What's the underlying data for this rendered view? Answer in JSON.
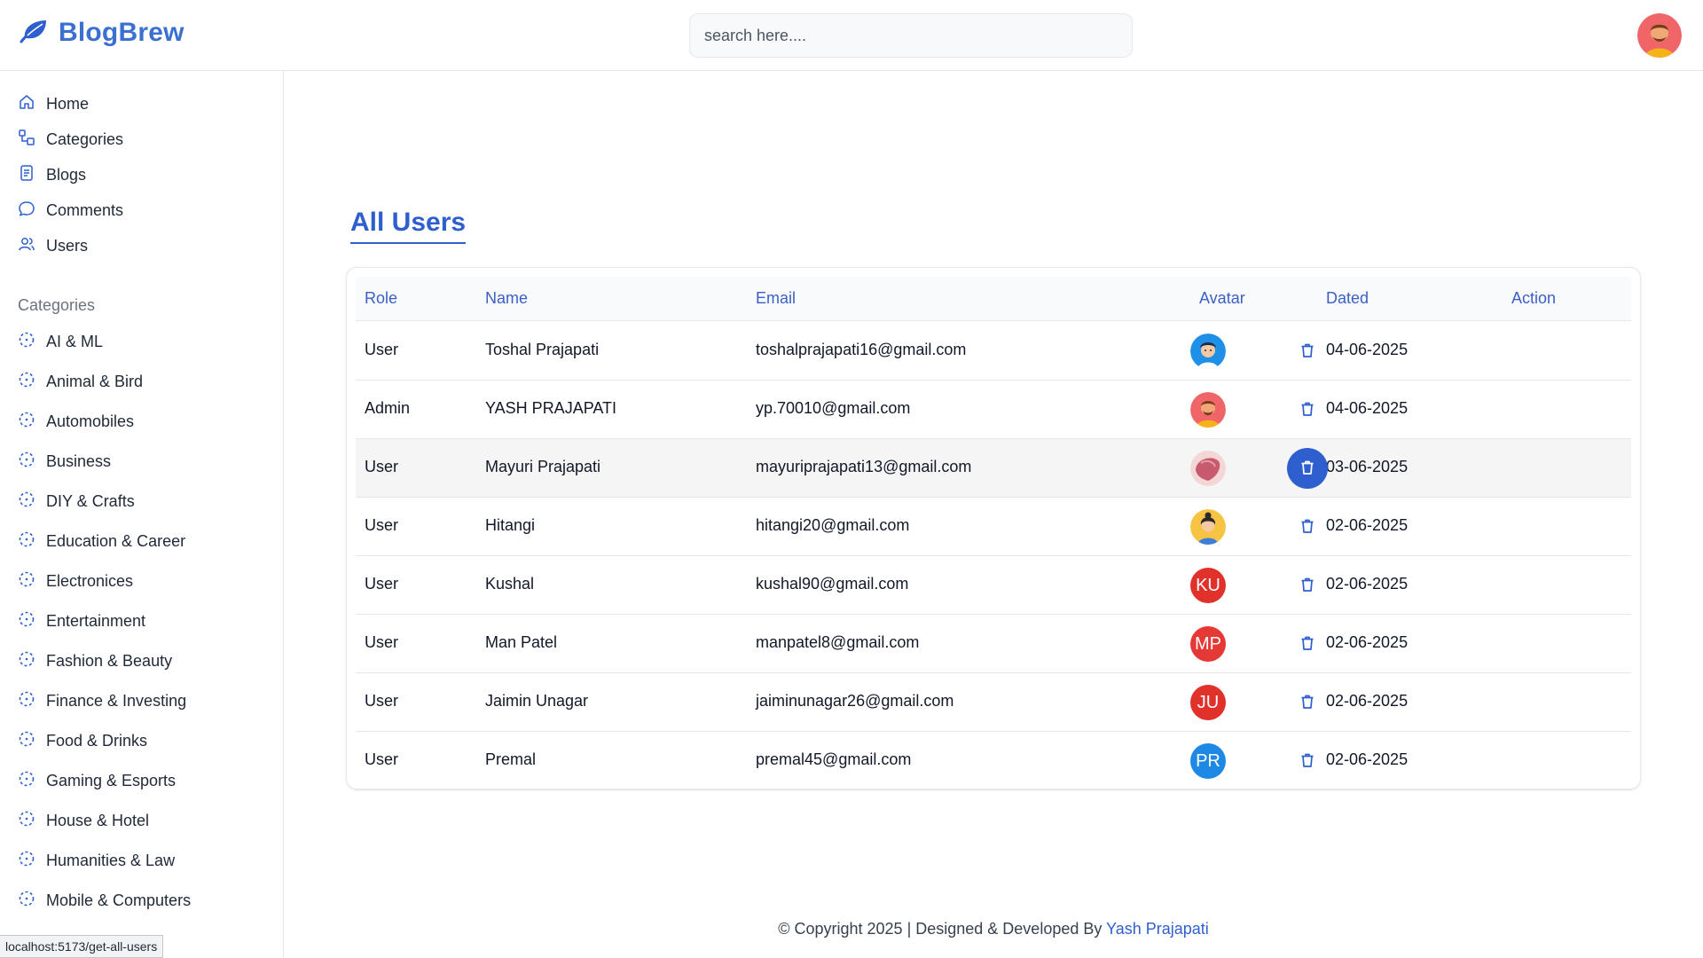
{
  "app": {
    "name": "BlogBrew"
  },
  "search": {
    "placeholder": "search here...."
  },
  "sidebar": {
    "nav": [
      {
        "label": "Home",
        "icon": "home-icon"
      },
      {
        "label": "Categories",
        "icon": "categories-icon"
      },
      {
        "label": "Blogs",
        "icon": "blogs-icon"
      },
      {
        "label": "Comments",
        "icon": "comment-icon"
      },
      {
        "label": "Users",
        "icon": "users-icon"
      }
    ],
    "categories_heading": "Categories",
    "categories": [
      "AI & ML",
      "Animal & Bird",
      "Automobiles",
      "Business",
      "DIY & Crafts",
      "Education & Career",
      "Electronices",
      "Entertainment",
      "Fashion & Beauty",
      "Finance & Investing",
      "Food & Drinks",
      "Gaming & Esports",
      "House & Hotel",
      "Humanities & Law",
      "Mobile & Computers"
    ]
  },
  "main": {
    "title": "All Users",
    "columns": [
      "Role",
      "Name",
      "Email",
      "Avatar",
      "Dated",
      "Action"
    ],
    "rows": [
      {
        "role": "User",
        "name": "Toshal Prajapati",
        "email": "toshalprajapati16@gmail.com",
        "avatar": "illustration-boy",
        "dated": "04-06-2025"
      },
      {
        "role": "Admin",
        "name": "YASH PRAJAPATI",
        "email": "yp.70010@gmail.com",
        "avatar": "illustration-man-beard",
        "dated": "04-06-2025"
      },
      {
        "role": "User",
        "name": "Mayuri Prajapati",
        "email": "mayuriprajapati13@gmail.com",
        "avatar": "illustration-pink",
        "dated": "03-06-2025"
      },
      {
        "role": "User",
        "name": "Hitangi",
        "email": "hitangi20@gmail.com",
        "avatar": "illustration-girl",
        "dated": "02-06-2025"
      },
      {
        "role": "User",
        "name": "Kushal",
        "email": "kushal90@gmail.com",
        "avatar": "KU",
        "avatar_color": "#e0312b",
        "dated": "02-06-2025"
      },
      {
        "role": "User",
        "name": "Man Patel",
        "email": "manpatel8@gmail.com",
        "avatar": "MP",
        "avatar_color": "#e53935",
        "dated": "02-06-2025"
      },
      {
        "role": "User",
        "name": "Jaimin Unagar",
        "email": "jaiminunagar26@gmail.com",
        "avatar": "JU",
        "avatar_color": "#e0312b",
        "dated": "02-06-2025"
      },
      {
        "role": "User",
        "name": "Premal",
        "email": "premal45@gmail.com",
        "avatar": "PR",
        "avatar_color": "#1e88e5",
        "dated": "02-06-2025"
      }
    ],
    "action_icon": "trash-icon"
  },
  "footer": {
    "text": "© Copyright 2025 | Designed & Developed By ",
    "author": "Yash Prajapati"
  },
  "statusbar": {
    "url": "localhost:5173/get-all-users"
  },
  "colors": {
    "accent": "#2f5fcf",
    "logo": "#3b6fd0"
  }
}
